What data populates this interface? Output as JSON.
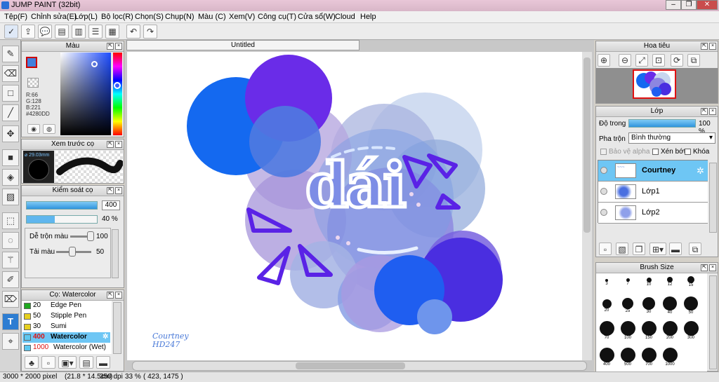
{
  "app": {
    "title": "JUMP PAINT (32bit)"
  },
  "menu": [
    "Tệp(F)",
    "Chỉnh sửa(E)",
    "Lớp(L)",
    "Bộ lọc(R)",
    "Chọn(S)",
    "Chụp(N)",
    "Màu (C)",
    "Xem(V)",
    "Công cụ(T)",
    "Cửa sổ(W)",
    "Cloud",
    "Help"
  ],
  "color_panel": {
    "title": "Màu",
    "r": "R:66",
    "g": "G:128",
    "b": "B:221",
    "hex": "#4280DD",
    "main_color": "#4280DD"
  },
  "brush_preview": {
    "title": "Xem trước cọ",
    "size": "29.03mm"
  },
  "brush_control": {
    "title": "Kiểm soát cọ",
    "size_value": "400",
    "opacity_value": "40 %",
    "blend_label": "Dễ trộn màu",
    "blend_value": "100",
    "amount_label": "Tải màu",
    "amount_value": "50"
  },
  "brush_list": {
    "title": "Cọ: Watercolor",
    "items": [
      {
        "num": "20",
        "name": "Edge Pen",
        "color": "#1fa81f"
      },
      {
        "num": "50",
        "name": "Stipple Pen",
        "color": "#e6d020"
      },
      {
        "num": "30",
        "name": "Sumi",
        "color": "#e6d020"
      },
      {
        "num": "400",
        "name": "Watercolor",
        "color": "#5ec8f0",
        "selected": true
      },
      {
        "num": "1000",
        "name": "Watercolor (Wet)",
        "color": "#5ec8f0"
      }
    ]
  },
  "document": {
    "tab": "Untitled",
    "title_text": "dái",
    "signature_line1": "Courtney",
    "signature_line2": "HD247"
  },
  "navigator": {
    "title": "Hoa tiêu"
  },
  "layers": {
    "title": "Lớp",
    "opacity_label": "Độ trong",
    "opacity_value": "100 %",
    "blend_label": "Pha trộn",
    "blend_value": "Bình thường",
    "protect_alpha": "Bảo vệ alpha",
    "clip": "Xén bớt",
    "lock": "Khóa",
    "items": [
      {
        "name": "Courtney",
        "selected": true
      },
      {
        "name": "Lớp1",
        "selected": false
      },
      {
        "name": "Lớp2",
        "selected": false
      }
    ]
  },
  "brush_size": {
    "title": "Brush Size",
    "sizes": [
      "3",
      "7",
      "10",
      "12",
      "15",
      "20",
      "25",
      "30",
      "40",
      "50",
      "70",
      "100",
      "150",
      "200",
      "300",
      "400",
      "500",
      "700",
      "1000"
    ]
  },
  "status": {
    "dims": "3000 * 2000 pixel",
    "cm": "(21.8 * 14.5cm)",
    "dpi": "350 dpi",
    "zoom": "33 %",
    "coords": "( 423, 1475 )"
  }
}
